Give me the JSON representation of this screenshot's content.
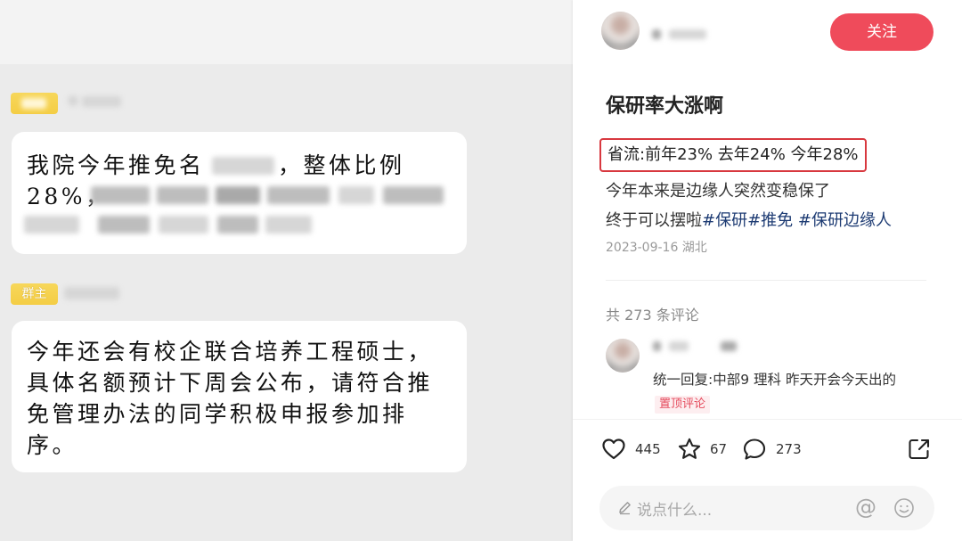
{
  "colors": {
    "accent": "#ef4b5b",
    "tag-color": "#1d3b73",
    "highlight-border": "#d8383f",
    "pinned-bg": "#fdeef0",
    "badge-yellow": "#f4cd45"
  },
  "image": {
    "messages": [
      {
        "line1_start": "我院今年推免名",
        "line1_end": "，整体比例",
        "line2_start": "28%，"
      },
      {
        "badge": "群主",
        "lines": [
          "今年还会有校企联合培养工程硕士，",
          "具体名额预计下周会公布，请符合推",
          "免管理办法的同学积极申报参加排",
          "序。"
        ]
      }
    ]
  },
  "author": {
    "follow_label": "关注"
  },
  "post": {
    "title": "保研率大涨啊",
    "highlight": "省流:前年23% 去年24% 今年28%",
    "line2": "今年本来是边缘人突然变稳保了",
    "line3_text": "终于可以摆啦",
    "tags": [
      "#保研",
      "#推免",
      "#保研边缘人"
    ],
    "date_location": "2023-09-16 湖北"
  },
  "comments": {
    "count_label": "共 273 条评论",
    "items": [
      {
        "text": "统一回复:中部9 理科 昨天开会今天出的",
        "badge": "置顶评论"
      }
    ]
  },
  "actions": {
    "likes": "445",
    "collects": "67",
    "comments": "273",
    "icons": [
      "heart-icon",
      "star-icon",
      "comment-icon",
      "share-icon"
    ]
  },
  "input": {
    "placeholder": "说点什么...",
    "mention_glyph": "@",
    "icons": [
      "pencil-icon",
      "emoji-icon"
    ]
  }
}
